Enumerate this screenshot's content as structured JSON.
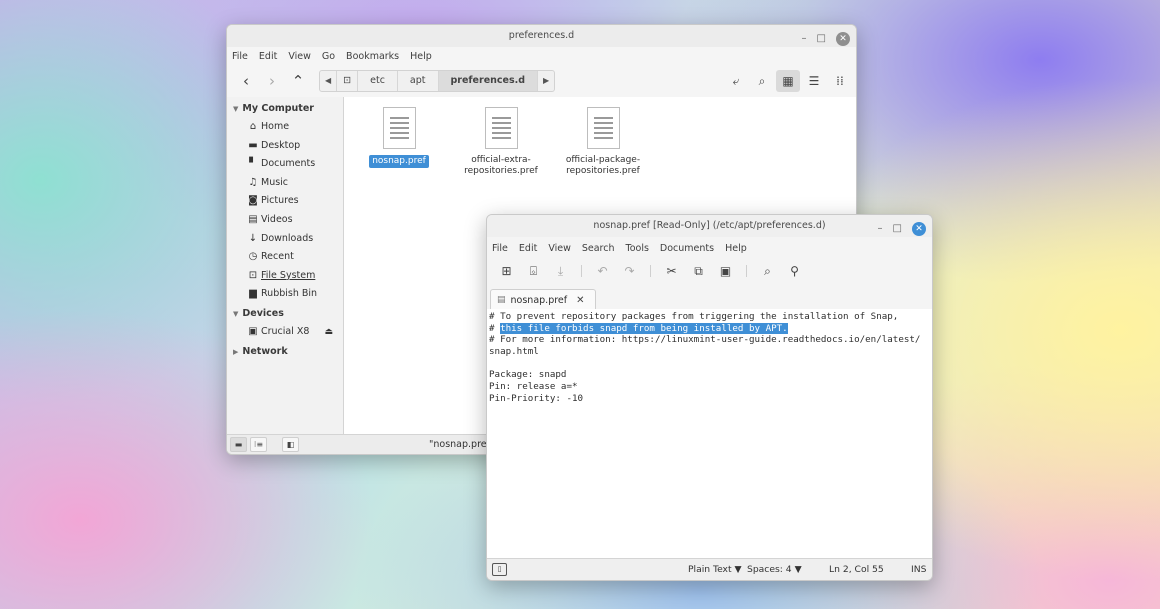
{
  "file_manager": {
    "title": "preferences.d",
    "menu": [
      "File",
      "Edit",
      "View",
      "Go",
      "Bookmarks",
      "Help"
    ],
    "breadcrumbs": [
      "etc",
      "apt",
      "preferences.d"
    ],
    "sidebar": {
      "my_computer": "My Computer",
      "places": [
        {
          "label": "Home",
          "icon": "home-icon"
        },
        {
          "label": "Desktop",
          "icon": "desktop-icon"
        },
        {
          "label": "Documents",
          "icon": "documents-icon"
        },
        {
          "label": "Music",
          "icon": "music-icon"
        },
        {
          "label": "Pictures",
          "icon": "pictures-icon"
        },
        {
          "label": "Videos",
          "icon": "videos-icon"
        },
        {
          "label": "Downloads",
          "icon": "downloads-icon"
        },
        {
          "label": "Recent",
          "icon": "recent-icon"
        },
        {
          "label": "File System",
          "icon": "filesystem-icon"
        },
        {
          "label": "Rubbish Bin",
          "icon": "trash-icon"
        }
      ],
      "devices_header": "Devices",
      "devices": [
        {
          "label": "Crucial X8",
          "icon": "drive-icon"
        }
      ],
      "network_header": "Network"
    },
    "files": [
      {
        "name": "nosnap.pref",
        "selected": true
      },
      {
        "name": "official-extra-repositories.pref",
        "selected": false
      },
      {
        "name": "official-package-repositories.pref",
        "selected": false
      }
    ],
    "status": "\"nosnap.pref\""
  },
  "editor": {
    "title": "nosnap.pref [Read-Only] (/etc/apt/preferences.d)",
    "menu": [
      "File",
      "Edit",
      "View",
      "Search",
      "Tools",
      "Documents",
      "Help"
    ],
    "tab_label": "nosnap.pref",
    "lines": [
      "# To prevent repository packages from triggering the installation of Snap,",
      "# ",
      "# For more information: https://linuxmint-user-guide.readthedocs.io/en/latest/",
      "snap.html",
      "",
      "Package: snapd",
      "Pin: release a=*",
      "Pin-Priority: -10"
    ],
    "highlighted_text": "this file forbids snapd from being installed by APT.",
    "status": {
      "syntax": "Plain Text ▼",
      "spaces": "Spaces: 4 ▼",
      "position": "Ln 2, Col 55",
      "mode": "INS"
    }
  },
  "colors": {
    "accent": "#3f8fd6"
  }
}
